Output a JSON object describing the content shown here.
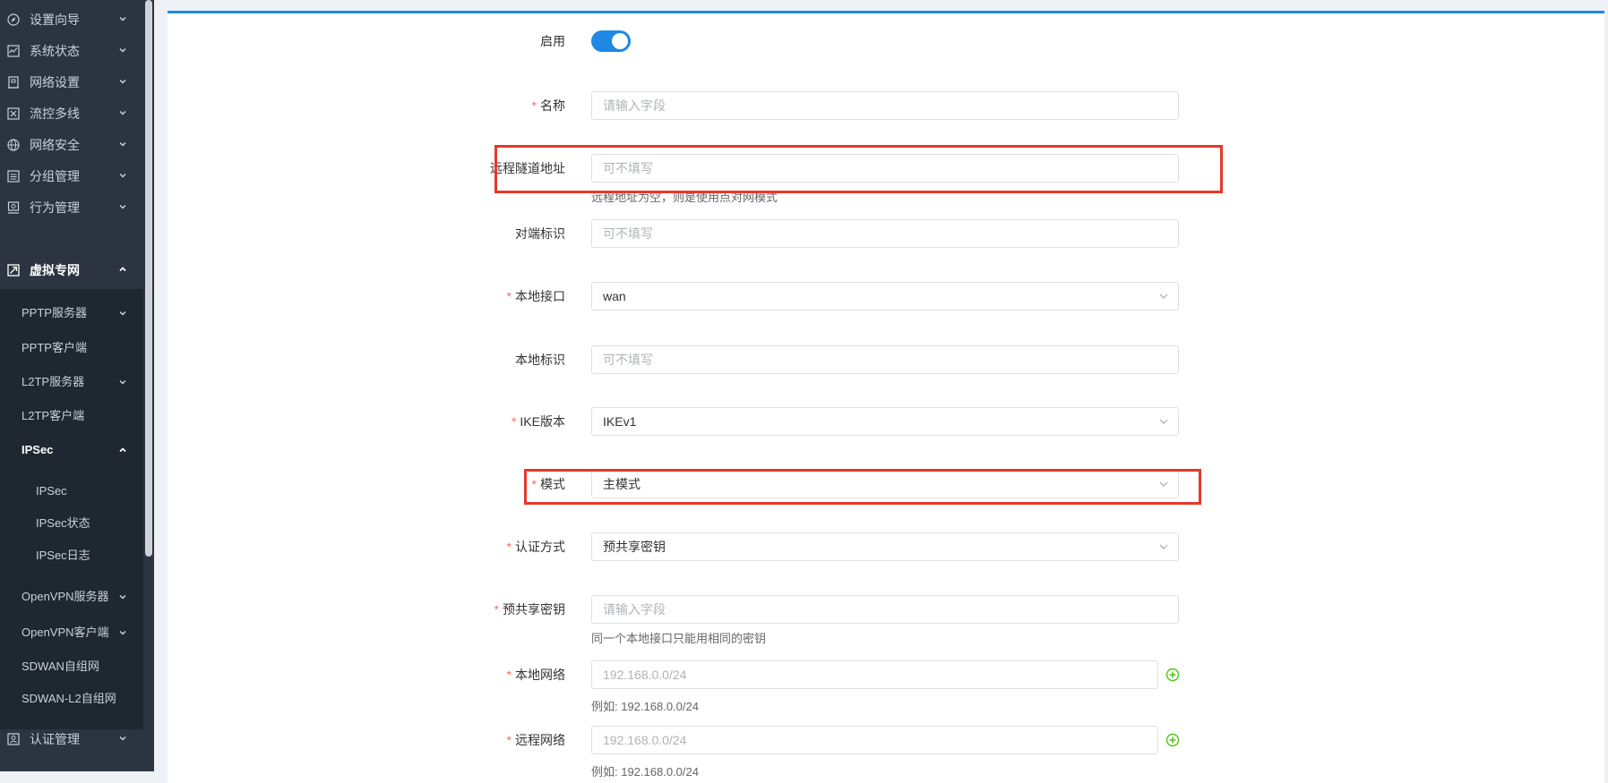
{
  "sidebar": {
    "menu": [
      {
        "label": "设置向导",
        "icon": "compass-icon",
        "expanded": false
      },
      {
        "label": "系统状态",
        "icon": "chart-icon",
        "expanded": false
      },
      {
        "label": "网络设置",
        "icon": "building-icon",
        "expanded": false
      },
      {
        "label": "流控多线",
        "icon": "traffic-icon",
        "expanded": false
      },
      {
        "label": "网络安全",
        "icon": "globe-icon",
        "expanded": false
      },
      {
        "label": "分组管理",
        "icon": "list-icon",
        "expanded": false
      },
      {
        "label": "行为管理",
        "icon": "monitor-icon",
        "expanded": false
      },
      {
        "label": "虚拟专网",
        "icon": "vpn-icon",
        "expanded": true
      }
    ],
    "vpn_sub": [
      {
        "label": "PPTP服务器",
        "chevron": true
      },
      {
        "label": "PPTP客户端",
        "chevron": false
      },
      {
        "label": "L2TP服务器",
        "chevron": true
      },
      {
        "label": "L2TP客户端",
        "chevron": false
      },
      {
        "label": "IPSec",
        "chevron": true,
        "open": true
      }
    ],
    "ipsec_sub": [
      "IPSec",
      "IPSec状态",
      "IPSec日志"
    ],
    "vpn_sub_more": [
      {
        "label": "OpenVPN服务器",
        "chevron": true
      },
      {
        "label": "OpenVPN客户端",
        "chevron": true
      },
      {
        "label": "SDWAN自组网",
        "chevron": false
      },
      {
        "label": "SDWAN-L2自组网",
        "chevron": false
      }
    ],
    "bottom_menu": {
      "label": "认证管理",
      "icon": "auth-icon"
    }
  },
  "form": {
    "enable": {
      "label": "启用",
      "on": true
    },
    "name": {
      "label": "名称",
      "required": true,
      "placeholder": "请输入字段"
    },
    "remote_tunnel": {
      "label": "远程隧道地址",
      "required": false,
      "placeholder": "可不填写",
      "hint": "远程地址为空，则是使用点对网模式"
    },
    "peer_id": {
      "label": "对端标识",
      "required": false,
      "placeholder": "可不填写"
    },
    "local_iface": {
      "label": "本地接口",
      "required": true,
      "value": "wan"
    },
    "local_id": {
      "label": "本地标识",
      "required": false,
      "placeholder": "可不填写"
    },
    "ike_version": {
      "label": "IKE版本",
      "required": true,
      "value": "IKEv1"
    },
    "mode": {
      "label": "模式",
      "required": true,
      "value": "主模式"
    },
    "auth_method": {
      "label": "认证方式",
      "required": true,
      "value": "预共享密钥"
    },
    "psk": {
      "label": "预共享密钥",
      "required": true,
      "placeholder": "请输入字段",
      "hint": "同一个本地接口只能用相同的密钥"
    },
    "local_net": {
      "label": "本地网络",
      "required": true,
      "placeholder": "192.168.0.0/24",
      "hint": "例如: 192.168.0.0/24"
    },
    "remote_net": {
      "label": "远程网络",
      "required": true,
      "placeholder": "192.168.0.0/24",
      "hint": "例如: 192.168.0.0/24"
    },
    "required_mark": "*"
  },
  "colors": {
    "accent": "#1e88e5",
    "highlight": "#e53929",
    "required": "#f56c6c",
    "add": "#52c41a"
  }
}
